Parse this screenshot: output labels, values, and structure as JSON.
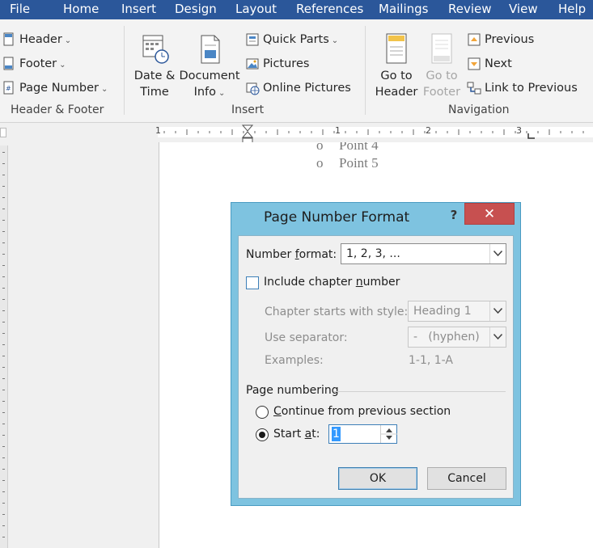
{
  "menu": [
    "File",
    "Home",
    "Insert",
    "Design",
    "Layout",
    "References",
    "Mailings",
    "Review",
    "View",
    "Help"
  ],
  "ribbon": {
    "header_footer": {
      "header": "Header",
      "footer": "Footer",
      "page_number": "Page Number",
      "group_label": "Header & Footer"
    },
    "insert": {
      "date_time_1": "Date &",
      "date_time_2": "Time",
      "doc_info_1": "Document",
      "doc_info_2": "Info",
      "quick_parts": "Quick Parts",
      "pictures": "Pictures",
      "online_pictures": "Online Pictures",
      "group_label": "Insert"
    },
    "navigation": {
      "go_header_1": "Go to",
      "go_header_2": "Header",
      "go_footer_1": "Go to",
      "go_footer_2": "Footer",
      "previous": "Previous",
      "next": "Next",
      "link_previous": "Link to Previous",
      "group_label": "Navigation"
    }
  },
  "ruler": {
    "marks": [
      "1",
      "1",
      "2",
      "3"
    ]
  },
  "document": {
    "bullet_partial": "Point 4",
    "bullet": "Point 5"
  },
  "dialog": {
    "title": "Page Number Format",
    "help": "?",
    "close": "✕",
    "number_format_label": "Number format:",
    "number_format_value": "1, 2, 3, ...",
    "include_chapter": "Include chapter number",
    "chapter_style_label": "Chapter starts with style:",
    "chapter_style_value": "Heading 1",
    "separator_label": "Use separator:",
    "separator_value": "-   (hyphen)",
    "examples_label": "Examples:",
    "examples_value": "1-1, 1-A",
    "page_numbering": "Page numbering",
    "continue_label": "Continue from previous section",
    "start_at_label": "Start at:",
    "start_at_value": "1",
    "ok": "OK",
    "cancel": "Cancel"
  },
  "colors": {
    "menubar": "#2b579a",
    "dialog_frame": "#7ec3e0",
    "close_button": "#c75050"
  }
}
